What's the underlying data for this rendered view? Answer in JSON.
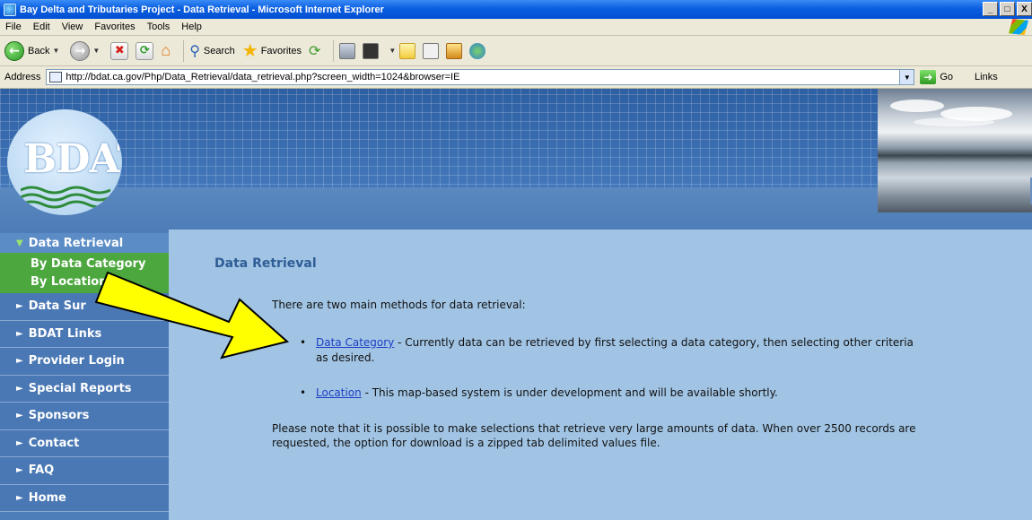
{
  "window": {
    "title": "Bay Delta and Tributaries Project - Data Retrieval - Microsoft Internet Explorer",
    "min": "_",
    "max": "□",
    "close": "X"
  },
  "menu": [
    "File",
    "Edit",
    "View",
    "Favorites",
    "Tools",
    "Help"
  ],
  "toolbar": {
    "back_label": "Back",
    "search_label": "Search",
    "favorites_label": "Favorites"
  },
  "address": {
    "label": "Address",
    "url": "http://bdat.ca.gov/Php/Data_Retrieval/data_retrieval.php?screen_width=1024&browser=IE",
    "go_label": "Go",
    "links_label": "Links"
  },
  "logo_text": "BDAT",
  "sidebar": {
    "active": "Data Retrieval",
    "sub": [
      "By Data Category",
      "By Location"
    ],
    "items": [
      "Data Sur",
      "BDAT Links",
      "Provider Login",
      "Special Reports",
      "Sponsors",
      "Contact",
      "FAQ",
      "Home"
    ]
  },
  "content": {
    "title": "Data Retrieval",
    "intro": "There are two main methods for data retrieval:",
    "bullet1_link": "Data Category",
    "bullet1_text": " - Currently data can be retrieved by first selecting a data category, then selecting other criteria as desired.",
    "bullet2_link": "Location",
    "bullet2_text": " - This map-based system is under development and will be available shortly.",
    "note": "Please note that it is possible to make selections that retrieve very large amounts of data. When over 2500 records are requested, the option for download is a zipped tab delimited values file."
  },
  "colors": {
    "sidebar": "#4e7eb9",
    "content_bg": "#a1c4e4",
    "active_sub": "#4ca83e",
    "arrow": "#ffff00"
  }
}
